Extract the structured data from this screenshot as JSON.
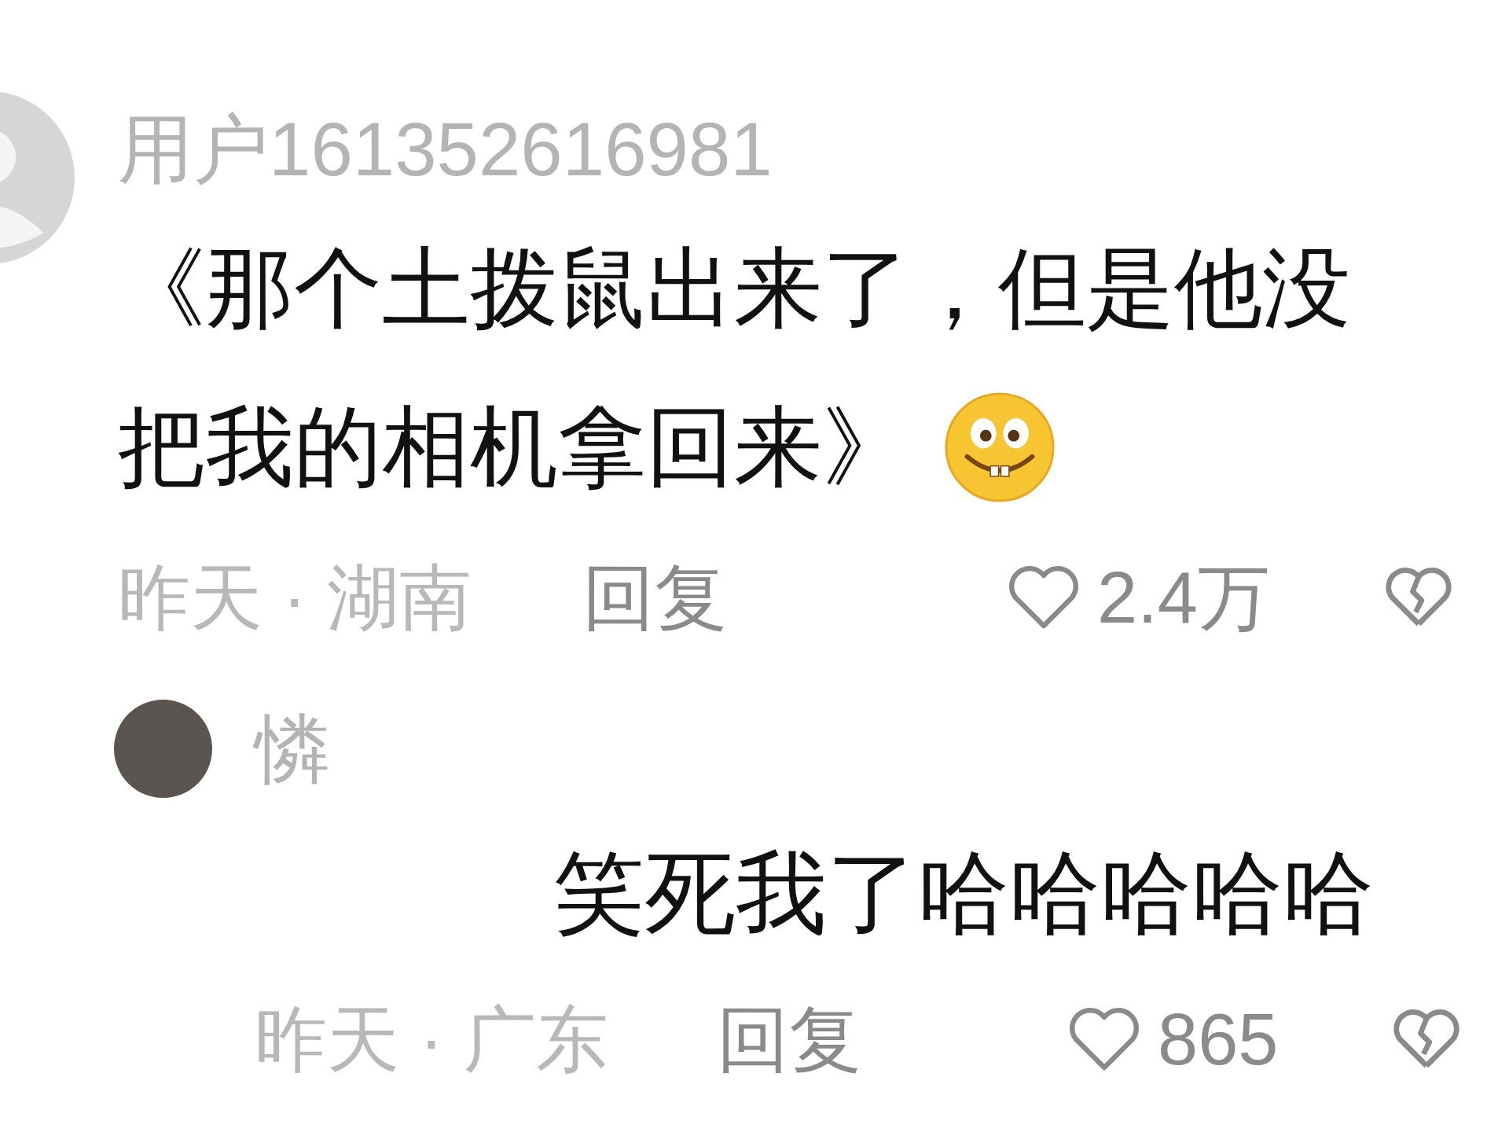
{
  "comment": {
    "username": "用户161352616981",
    "text_lines": [
      "《那个土拨鼠出来了，但是他没",
      "把我的相机拿回来》"
    ],
    "meta": "昨天 · 湖南",
    "reply_label": "回复",
    "likes": "2.4万"
  },
  "reply": {
    "username": "憐",
    "text": "笑死我了哈哈哈哈哈",
    "meta": "昨天 · 广东",
    "reply_label": "回复",
    "likes": "865"
  }
}
